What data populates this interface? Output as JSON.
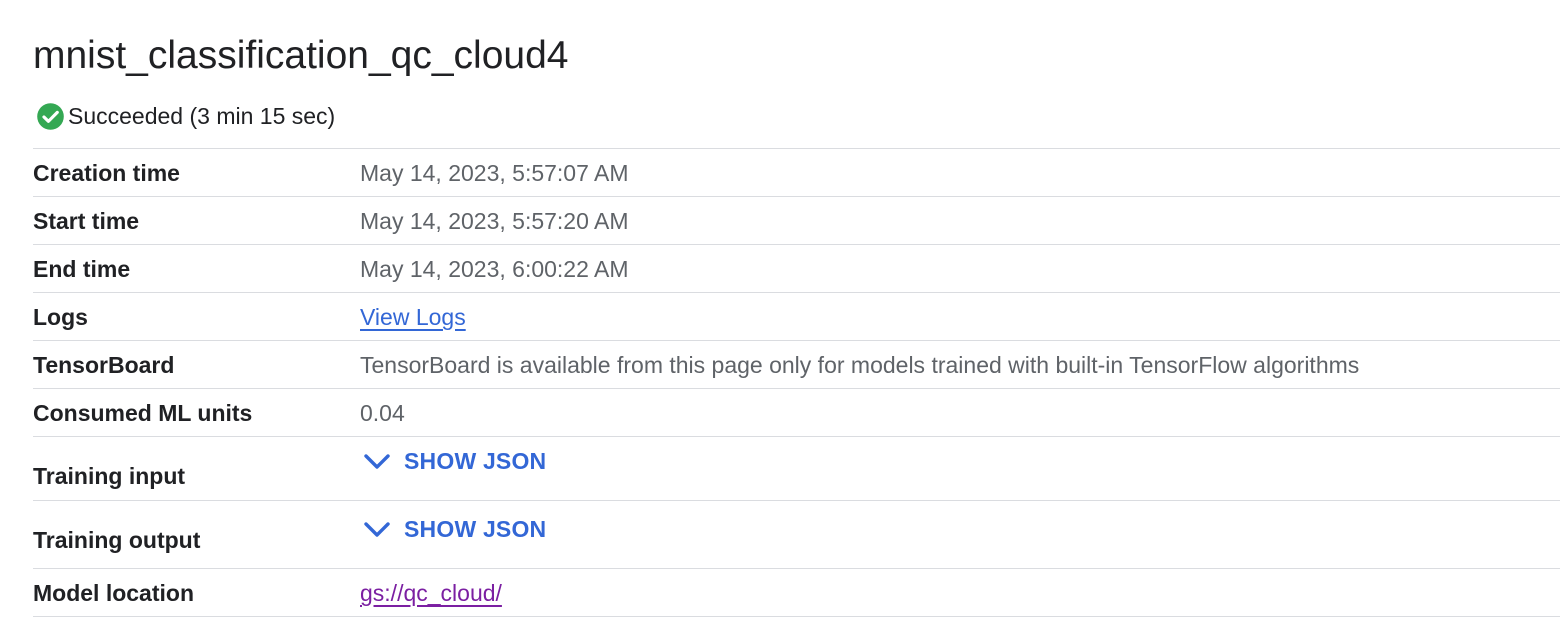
{
  "job": {
    "title": "mnist_classification_qc_cloud4",
    "status": {
      "text": "Succeeded (3 min 15 sec)",
      "icon": "check-circle-icon",
      "color": "#34a853"
    }
  },
  "details": {
    "creation_time": {
      "label": "Creation time",
      "value": "May 14, 2023, 5:57:07 AM"
    },
    "start_time": {
      "label": "Start time",
      "value": "May 14, 2023, 5:57:20 AM"
    },
    "end_time": {
      "label": "End time",
      "value": "May 14, 2023, 6:00:22 AM"
    },
    "logs": {
      "label": "Logs",
      "link": "View Logs"
    },
    "tensorboard": {
      "label": "TensorBoard",
      "value": "TensorBoard is available from this page only for models trained with built-in TensorFlow algorithms"
    },
    "ml_units": {
      "label": "Consumed ML units",
      "value": "0.04"
    },
    "training_input": {
      "label": "Training input",
      "toggle": "SHOW JSON",
      "icon": "chevron-down-icon"
    },
    "training_output": {
      "label": "Training output",
      "toggle": "SHOW JSON",
      "icon": "chevron-down-icon"
    },
    "model_location": {
      "label": "Model location",
      "link": "gs://qc_cloud/"
    }
  },
  "colors": {
    "link": "#3367d6",
    "visited_link": "#7b1fa2",
    "divider": "#dadce0",
    "value_text": "#5f6368"
  }
}
